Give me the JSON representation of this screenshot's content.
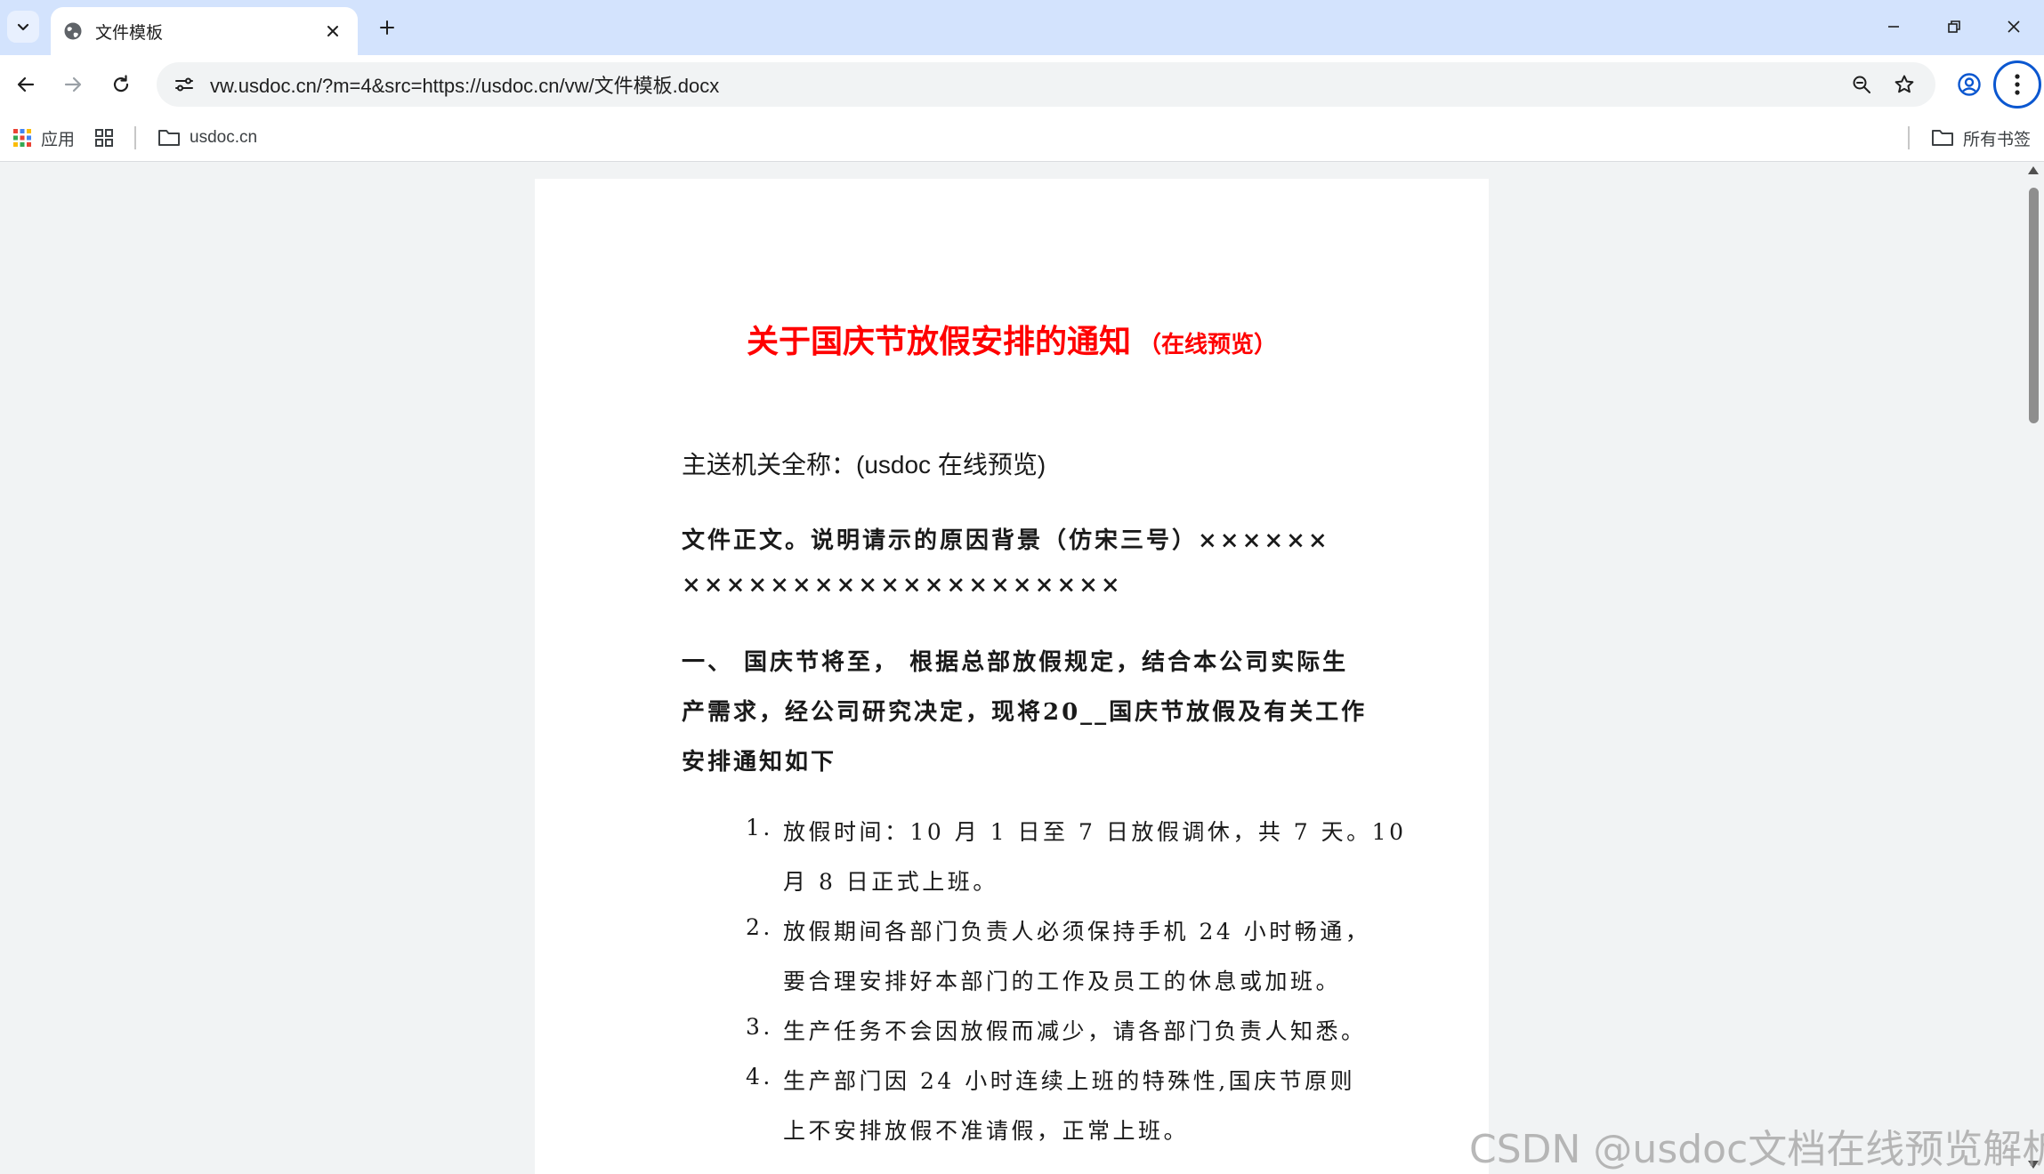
{
  "browser": {
    "tab_title": "文件模板",
    "new_tab_symbol": "+",
    "url": "vw.usdoc.cn/?m=4&src=https://usdoc.cn/vw/文件模板.docx"
  },
  "bookmarks": {
    "apps_label": "应用",
    "folder_label": "usdoc.cn",
    "all_bookmarks_label": "所有书签"
  },
  "document": {
    "title": "关于国庆节放假安排的通知",
    "title_suffix": "（在线预览）",
    "recipient": "主送机关全称：(usdoc 在线预览)",
    "body_lines": [
      "文件正文。说明请示的原因背景（仿宋三号）××××××",
      "××××××××××××××××××××"
    ],
    "section_lines": [
      "一、 国庆节将至， 根据总部放假规定，结合本公司实际生",
      "产需求，经公司研究决定，现将20__国庆节放假及有关工作",
      "安排通知如下"
    ],
    "list": [
      {
        "num": "1.",
        "lines": [
          "放假时间：10 月 1 日至 7 日放假调休，共 7 天。10",
          "月 8 日正式上班。"
        ]
      },
      {
        "num": "2.",
        "lines": [
          "放假期间各部门负责人必须保持手机 24 小时畅通，",
          "要合理安排好本部门的工作及员工的休息或加班。"
        ]
      },
      {
        "num": "3.",
        "lines": [
          "生产任务不会因放假而减少，请各部门负责人知悉。"
        ]
      },
      {
        "num": "4.",
        "lines": [
          "生产部门因 24 小时连续上班的特殊性,国庆节原则",
          "上不安排放假不准请假，正常上班。"
        ]
      }
    ]
  },
  "watermark": "CSDN @usdoc文档在线预览解析",
  "colors": {
    "title_red": "#ff0000",
    "tabstrip_bg": "#d3e3fd",
    "accent_blue": "#0b57d0",
    "viewer_bg": "#f1f3f4"
  }
}
